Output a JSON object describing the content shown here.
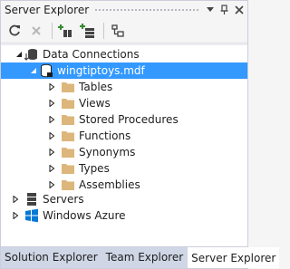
{
  "window": {
    "title": "Server Explorer"
  },
  "titlebar": {
    "dropdown_icon": "dropdown-arrow-icon",
    "pin_icon": "pin-icon",
    "close_icon": "close-icon"
  },
  "toolbar": {
    "buttons": [
      {
        "name": "refresh-icon"
      },
      {
        "name": "stop-icon"
      },
      {
        "name": "connect-to-database-icon"
      },
      {
        "name": "connect-to-server-icon"
      },
      {
        "name": "connect-to-sharepoint-icon"
      }
    ]
  },
  "tree": {
    "data_connections": "Data Connections",
    "database": "wingtiptoys.mdf",
    "folders": [
      {
        "label": "Tables"
      },
      {
        "label": "Views"
      },
      {
        "label": "Stored Procedures"
      },
      {
        "label": "Functions"
      },
      {
        "label": "Synonyms"
      },
      {
        "label": "Types"
      },
      {
        "label": "Assemblies"
      }
    ],
    "servers": "Servers",
    "azure": "Windows Azure"
  },
  "tabs": [
    {
      "label": "Solution Explorer",
      "active": false
    },
    {
      "label": "Team Explorer",
      "active": false
    },
    {
      "label": "Server Explorer",
      "active": true
    }
  ],
  "colors": {
    "selection": "#3399ff",
    "folder": "#dcb67a",
    "azure": "#0078d7"
  }
}
